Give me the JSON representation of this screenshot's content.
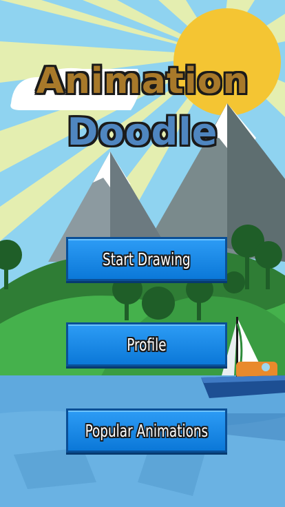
{
  "title": {
    "line1": "Animation",
    "line2": "Doodle"
  },
  "menu": {
    "start_drawing": "Start Drawing",
    "profile": "Profile",
    "popular_animations": "Popular Animations"
  },
  "colors": {
    "sky": "#8fd3f0",
    "sun": "#f4c533",
    "button": "#1e90f0",
    "water": "#5fa9de",
    "grass": "#3aa84a"
  }
}
